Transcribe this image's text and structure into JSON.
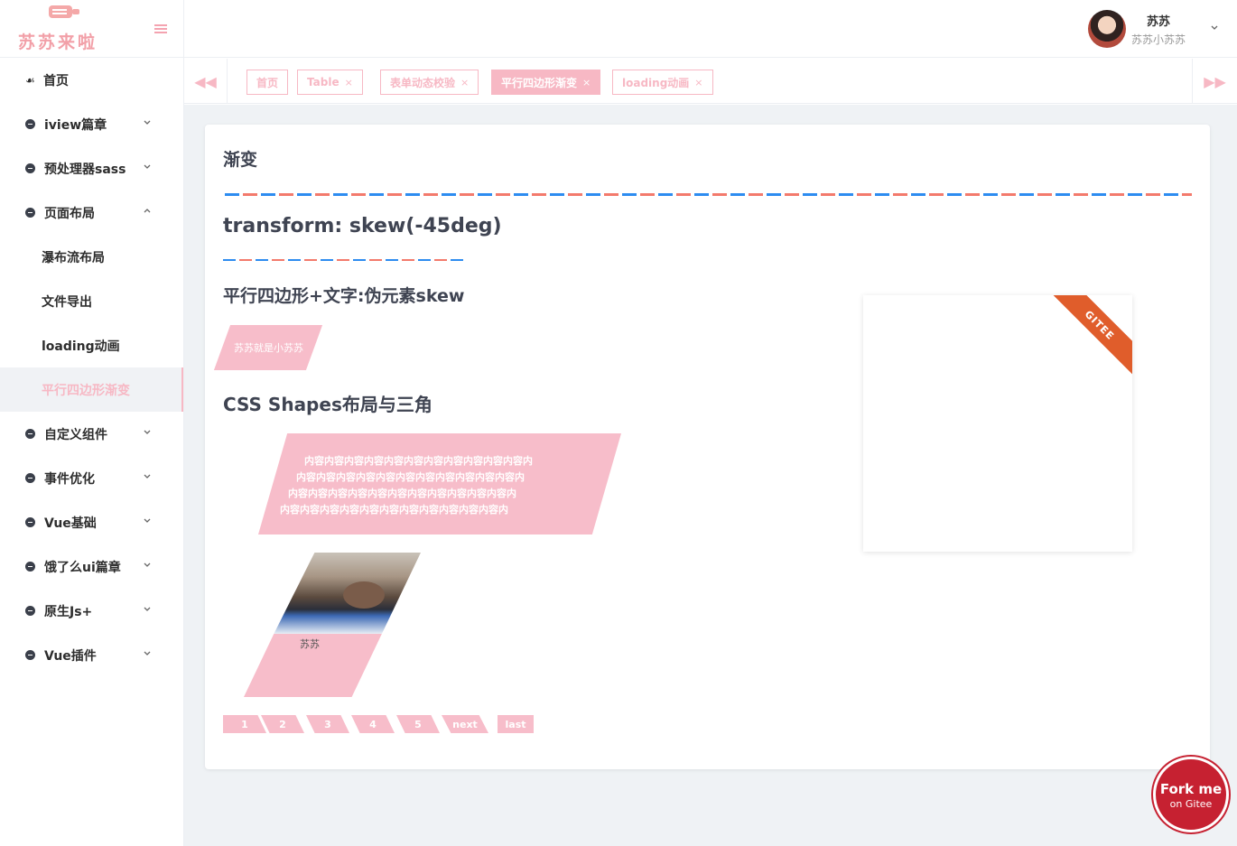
{
  "logo": {
    "text": "苏苏来啦"
  },
  "sidebar": {
    "items": [
      {
        "label": "首页",
        "icon": "paw-icon"
      },
      {
        "label": "iview篇章",
        "icon": "bullet-icon",
        "expandable": true
      },
      {
        "label": "预处理器sass",
        "icon": "bullet-icon",
        "expandable": true
      },
      {
        "label": "页面布局",
        "icon": "bullet-icon",
        "expandable": true,
        "expanded": true
      },
      {
        "label": "自定义组件",
        "icon": "bullet-icon",
        "expandable": true
      },
      {
        "label": "事件优化",
        "icon": "bullet-icon",
        "expandable": true
      },
      {
        "label": "Vue基础",
        "icon": "bullet-icon",
        "expandable": true
      },
      {
        "label": "饿了么ui篇章",
        "icon": "bullet-icon",
        "expandable": true
      },
      {
        "label": "原生Js+",
        "icon": "bullet-icon",
        "expandable": true
      },
      {
        "label": "Vue插件",
        "icon": "bullet-icon",
        "expandable": true
      }
    ],
    "sub_items": [
      {
        "label": "瀑布流布局"
      },
      {
        "label": "文件导出"
      },
      {
        "label": "loading动画"
      },
      {
        "label": "平行四边形渐变",
        "active": true
      }
    ]
  },
  "header": {
    "user_name": "苏苏",
    "user_sub": "苏苏小苏苏"
  },
  "tabs": [
    {
      "label": "首页",
      "closable": false
    },
    {
      "label": "Table",
      "closable": true
    },
    {
      "label": "表单动态校验",
      "closable": true
    },
    {
      "label": "平行四边形渐变",
      "closable": true,
      "active": true
    },
    {
      "label": "loading动画",
      "closable": true
    }
  ],
  "tab_close": "×",
  "nav_prev": "◀◀",
  "nav_next": "▶▶",
  "main": {
    "h_gradient": "渐变",
    "h_skew": "transform: skew(-45deg)",
    "h_para": "平行四边形+文字:伪元素skew",
    "skew_button": "苏苏就是小苏苏",
    "h_shapes": "CSS Shapes布局与三角",
    "shape_lines": [
      "内容内容内容内容内容内容内容内容内容内容内容内",
      "内容内容内容内容内容内容内容内容内容内容内容内",
      "内容内容内容内容内容内容内容内容内容内容内容内",
      "内容内容内容内容内容内容内容内容内容内容内容内"
    ],
    "photo_caption": "苏苏",
    "pager": [
      "1",
      "2",
      "3",
      "4",
      "5",
      "next",
      "last"
    ],
    "ribbon": "GITEE"
  },
  "forkme": {
    "line1": "Fork me",
    "line2": "on Gitee"
  },
  "colors": {
    "accent_pink": "#f7bdca",
    "dash_blue": "#2d8cf0",
    "dash_red": "#f37a6c",
    "fork_red": "#c62131"
  }
}
